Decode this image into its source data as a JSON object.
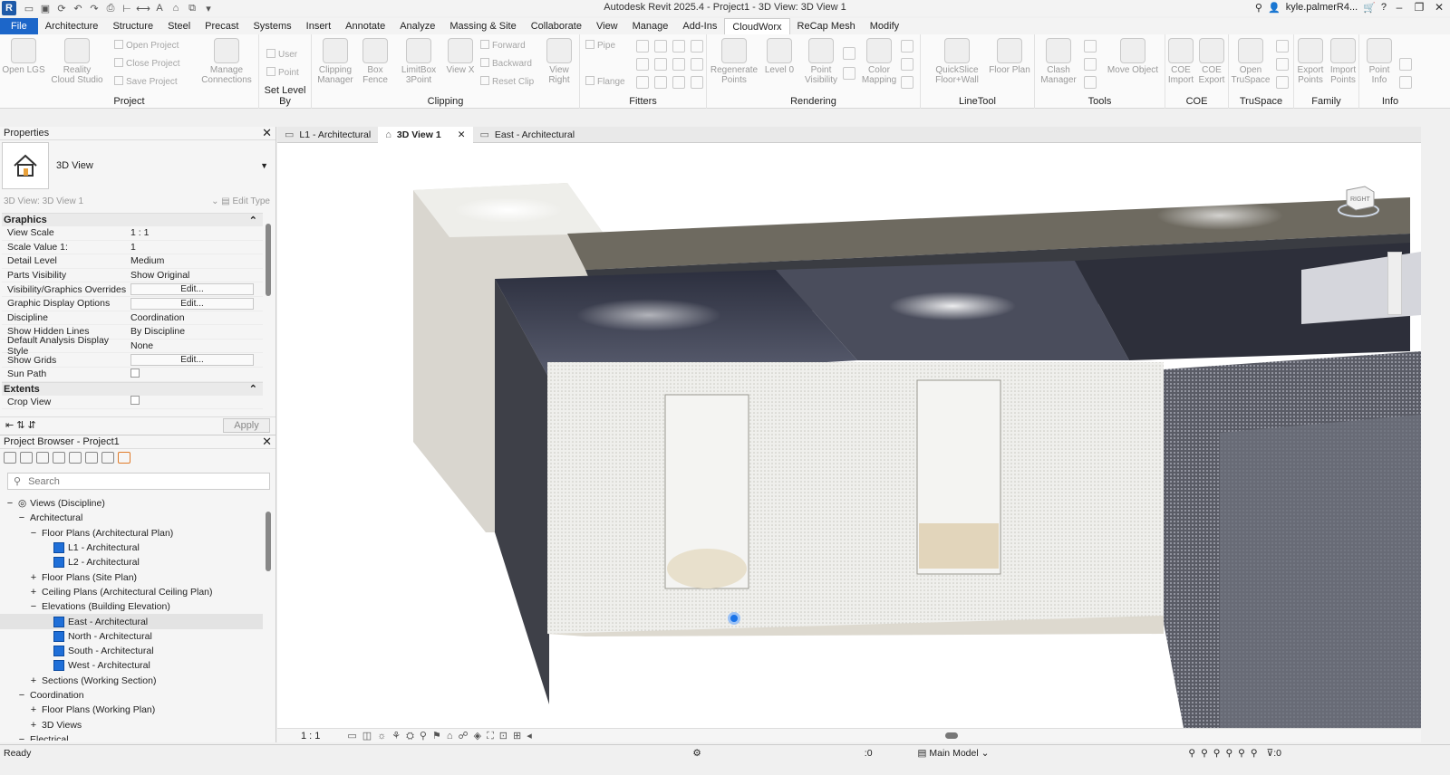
{
  "app": {
    "title": "Autodesk Revit 2025.4 - Project1 - 3D View: 3D View 1",
    "user": "kyle.palmerR4..."
  },
  "ribbon_tabs": [
    "File",
    "Architecture",
    "Structure",
    "Steel",
    "Precast",
    "Systems",
    "Insert",
    "Annotate",
    "Analyze",
    "Massing & Site",
    "Collaborate",
    "View",
    "Manage",
    "Add-Ins",
    "CloudWorx",
    "ReCap Mesh",
    "Modify"
  ],
  "ribbon": {
    "project": {
      "label": "Project",
      "open_lgs": "Open LGS",
      "reality_cloud": "Reality Cloud Studio",
      "manage_conn": "Manage Connections",
      "open_project": "Open Project",
      "close_project": "Close Project",
      "save_project": "Save Project"
    },
    "set_level": {
      "label": "Set Level By",
      "user": "User",
      "point": "Point"
    },
    "clipping": {
      "label": "Clipping",
      "clipping_manager": "Clipping Manager",
      "box_fence": "Box Fence",
      "limitbox": "LimitBox 3Point",
      "view_x": "View X",
      "forward": "Forward",
      "backward": "Backward",
      "reset_clip": "Reset Clip",
      "view_right": "View Right"
    },
    "fitters": {
      "label": "Fitters",
      "pipe": "Pipe",
      "flange": "Flange"
    },
    "rendering": {
      "label": "Rendering",
      "regen": "Regenerate Points",
      "level0": "Level 0",
      "point_vis": "Point Visibility",
      "color_map": "Color Mapping"
    },
    "linetool": {
      "label": "LineTool",
      "quickslice": "QuickSlice Floor+Wall",
      "floor_plan": "Floor Plan"
    },
    "tools": {
      "label": "Tools",
      "clash": "Clash Manager",
      "move_object": "Move Object"
    },
    "coe": {
      "label": "COE",
      "import": "COE Import",
      "export": "COE Export"
    },
    "truspace": {
      "label": "TruSpace",
      "open": "Open TruSpace"
    },
    "family": {
      "label": "Family",
      "export": "Export Points",
      "import": "Import Points"
    },
    "info": {
      "label": "Info",
      "point_info": "Point Info"
    }
  },
  "properties": {
    "title": "Properties",
    "type_name": "3D View",
    "instance": "3D View: 3D View 1",
    "edit_type": "Edit Type",
    "groups": [
      {
        "name": "Graphics",
        "rows": [
          {
            "label": "View Scale",
            "value": "1 : 1",
            "kind": "text"
          },
          {
            "label": "Scale Value    1:",
            "value": "1",
            "kind": "text"
          },
          {
            "label": "Detail Level",
            "value": "Medium",
            "kind": "text"
          },
          {
            "label": "Parts Visibility",
            "value": "Show Original",
            "kind": "text"
          },
          {
            "label": "Visibility/Graphics Overrides",
            "value": "Edit...",
            "kind": "button"
          },
          {
            "label": "Graphic Display Options",
            "value": "Edit...",
            "kind": "button"
          },
          {
            "label": "Discipline",
            "value": "Coordination",
            "kind": "text"
          },
          {
            "label": "Show Hidden Lines",
            "value": "By Discipline",
            "kind": "text"
          },
          {
            "label": "Default Analysis Display Style",
            "value": "None",
            "kind": "text"
          },
          {
            "label": "Show Grids",
            "value": "Edit...",
            "kind": "button"
          },
          {
            "label": "Sun Path",
            "value": "",
            "kind": "check"
          }
        ]
      },
      {
        "name": "Extents",
        "rows": [
          {
            "label": "Crop View",
            "value": "",
            "kind": "check"
          }
        ]
      }
    ],
    "apply": "Apply"
  },
  "browser": {
    "title": "Project Browser - Project1",
    "search_placeholder": "Search",
    "nodes": [
      {
        "level": 0,
        "exp": "−",
        "icon": "views",
        "label": "Views (Discipline)"
      },
      {
        "level": 1,
        "exp": "−",
        "icon": "",
        "label": "Architectural"
      },
      {
        "level": 2,
        "exp": "−",
        "icon": "",
        "label": "Floor Plans (Architectural Plan)"
      },
      {
        "level": 3,
        "exp": "",
        "icon": "view",
        "label": "L1 - Architectural"
      },
      {
        "level": 3,
        "exp": "",
        "icon": "view",
        "label": "L2 - Architectural"
      },
      {
        "level": 2,
        "exp": "+",
        "icon": "",
        "label": "Floor Plans (Site Plan)"
      },
      {
        "level": 2,
        "exp": "+",
        "icon": "",
        "label": "Ceiling Plans (Architectural Ceiling Plan)"
      },
      {
        "level": 2,
        "exp": "−",
        "icon": "",
        "label": "Elevations (Building Elevation)"
      },
      {
        "level": 3,
        "exp": "",
        "icon": "view",
        "label": "East - Architectural",
        "selected": true
      },
      {
        "level": 3,
        "exp": "",
        "icon": "view",
        "label": "North - Architectural"
      },
      {
        "level": 3,
        "exp": "",
        "icon": "view",
        "label": "South - Architectural"
      },
      {
        "level": 3,
        "exp": "",
        "icon": "view",
        "label": "West - Architectural"
      },
      {
        "level": 2,
        "exp": "+",
        "icon": "",
        "label": "Sections (Working Section)"
      },
      {
        "level": 1,
        "exp": "−",
        "icon": "",
        "label": "Coordination"
      },
      {
        "level": 2,
        "exp": "+",
        "icon": "",
        "label": "Floor Plans (Working Plan)"
      },
      {
        "level": 2,
        "exp": "+",
        "icon": "",
        "label": "3D Views"
      },
      {
        "level": 1,
        "exp": "−",
        "icon": "",
        "label": "Electrical"
      }
    ]
  },
  "view_tabs": [
    {
      "label": "L1 - Architectural",
      "active": false,
      "closable": false
    },
    {
      "label": "3D View 1",
      "active": true,
      "closable": true
    },
    {
      "label": "East - Architectural",
      "active": false,
      "closable": false
    }
  ],
  "viewport": {
    "scale": "1 : 1",
    "cube_label": "RIGHT"
  },
  "status": {
    "text": "Ready",
    "model": "Main Model",
    "count_a": ":0",
    "count_b": ":0"
  }
}
